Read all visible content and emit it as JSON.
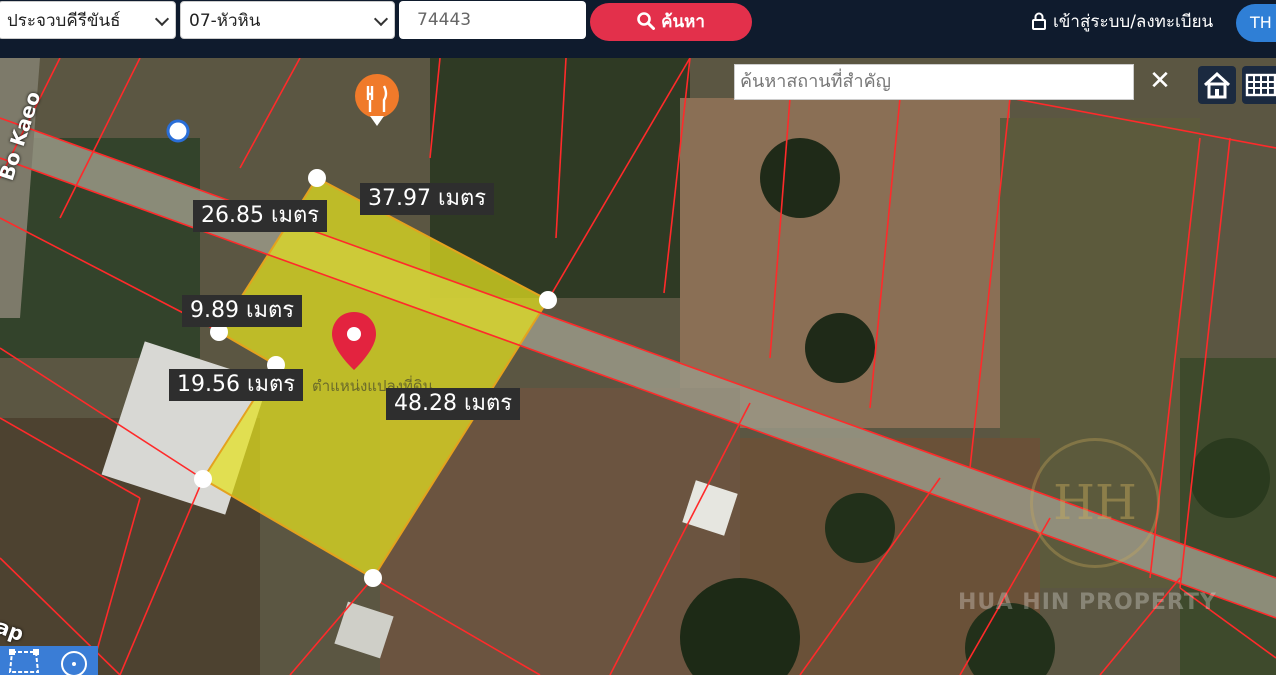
{
  "header": {
    "province": "ประจวบคีรีขันธ์",
    "district": "07-หัวหิน",
    "parcel_no": "74443",
    "search_label": "ค้นหา",
    "login_label": "เข้าสู่ระบบ/ลงทะเบียน",
    "lang": "TH"
  },
  "map": {
    "place_search_placeholder": "ค้นหาสถานที่สำคัญ",
    "clear_label": "✕",
    "road_label": "Bo Kaeo",
    "road_label2": "ap",
    "parcel_label": "ตำแหน่งแปลงที่ดิน",
    "measurements": [
      "26.85 เมตร",
      "37.97 เมตร",
      "9.89 เมตร",
      "19.56 เมตร",
      "48.28 เมตร"
    ],
    "watermark": "HUA HIN PROPERTY",
    "watermark_logo": "HH"
  },
  "colors": {
    "parcel_fill": "#e4e21e",
    "boundary": "#ff2a2a",
    "accent": "#e3304b",
    "pin": "#e3233f"
  },
  "icons": [
    "search-icon",
    "lock-icon",
    "restaurant-icon",
    "location-pin-icon",
    "home-icon",
    "grid-icon",
    "polygon-icon",
    "circle-icon"
  ]
}
